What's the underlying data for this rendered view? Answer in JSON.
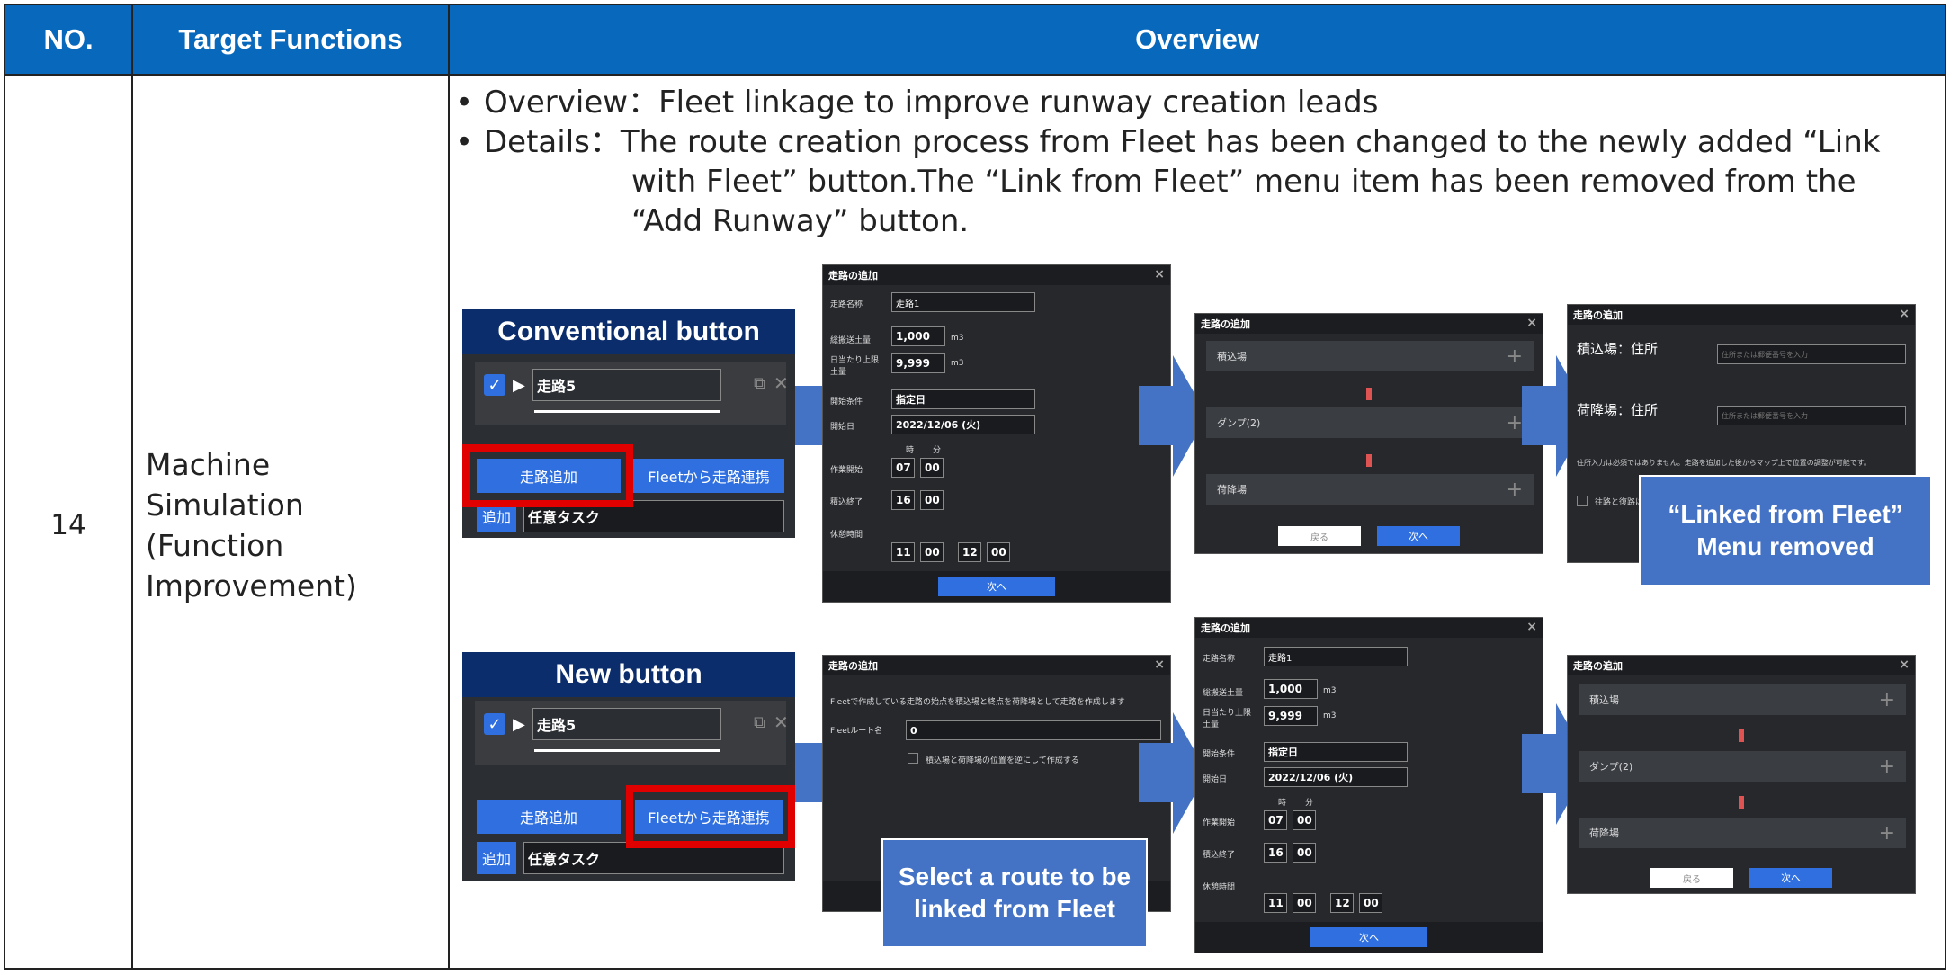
{
  "header": {
    "no": "NO.",
    "functions": "Target Functions",
    "overview": "Overview"
  },
  "row": {
    "no": "14",
    "function_lines": [
      "Machine",
      "Simulation",
      "(Function",
      "Improvement)"
    ],
    "overview_label": "Overview：Fleet linkage to improve runway creation leads",
    "details_line1": "Details：The route creation process from Fleet has been changed to the newly added “Link",
    "details_line2": "with Fleet” button.The “Link from Fleet” menu item has been removed from the",
    "details_line3": "“Add Runway” button."
  },
  "conventional": {
    "header": "Conventional button",
    "route_name": "走路5",
    "add_route": "走路追加",
    "fleet_link": "Fleetから走路連携",
    "add": "追加",
    "task": "任意タスク"
  },
  "new": {
    "header": "New button",
    "route_name": "走路5",
    "add_route": "走路追加",
    "fleet_link": "Fleetから走路連携",
    "add": "追加",
    "task": "任意タスク"
  },
  "dialog_form": {
    "title": "走路の追加",
    "name_label": "走路名称",
    "name_value": "走路1",
    "volume_label": "総搬送土量",
    "volume_value": "1,000",
    "unit": "m3",
    "daily_label": "日当たり上限土量",
    "daily_value": "9,999",
    "cond_label": "開始条件",
    "cond_value": "指定日",
    "date_label": "開始日",
    "date_value": "2022/12/06 (火)",
    "hour": "時",
    "minute": "分",
    "start_label": "作業開始",
    "start_h": "07",
    "start_m": "00",
    "end_label": "積込終了",
    "end_h": "16",
    "end_m": "00",
    "break_label": "休憩時間",
    "break_h1": "11",
    "break_m1": "00",
    "break_h2": "12",
    "break_m2": "00",
    "next": "次へ"
  },
  "dialog_points": {
    "title": "走路の追加",
    "load": "積込場",
    "dump": "ダンプ(2)",
    "unload": "荷降場",
    "back": "戻る",
    "next": "次へ"
  },
  "dialog_address": {
    "title": "走路の追加",
    "load_addr": "積込場：住所",
    "unload_addr": "荷降場：住所",
    "placeholder": "住所または郵便番号を入力",
    "note": "住所入力は必須ではありません。走路を追加した後からマップ上で位置の調整が可能です。",
    "check": "往路と復路は"
  },
  "dialog_fleet": {
    "title": "走路の追加",
    "desc": "Fleetで作成している走路の始点を積込場と終点を荷降場として走路を作成します",
    "route_label": "Fleetルート名",
    "route_value": "0",
    "reverse": "積込場と荷降場の位置を逆にして作成する"
  },
  "callouts": {
    "removed_line1": "“Linked from Fleet”",
    "removed_line2": "Menu removed",
    "select_line1": "Select a route to be",
    "select_line2": "linked from Fleet"
  },
  "colors": {
    "header_blue": "#0868BC",
    "navy": "#0c2d6b",
    "callout": "#4472C4",
    "highlight": "#e00000"
  }
}
